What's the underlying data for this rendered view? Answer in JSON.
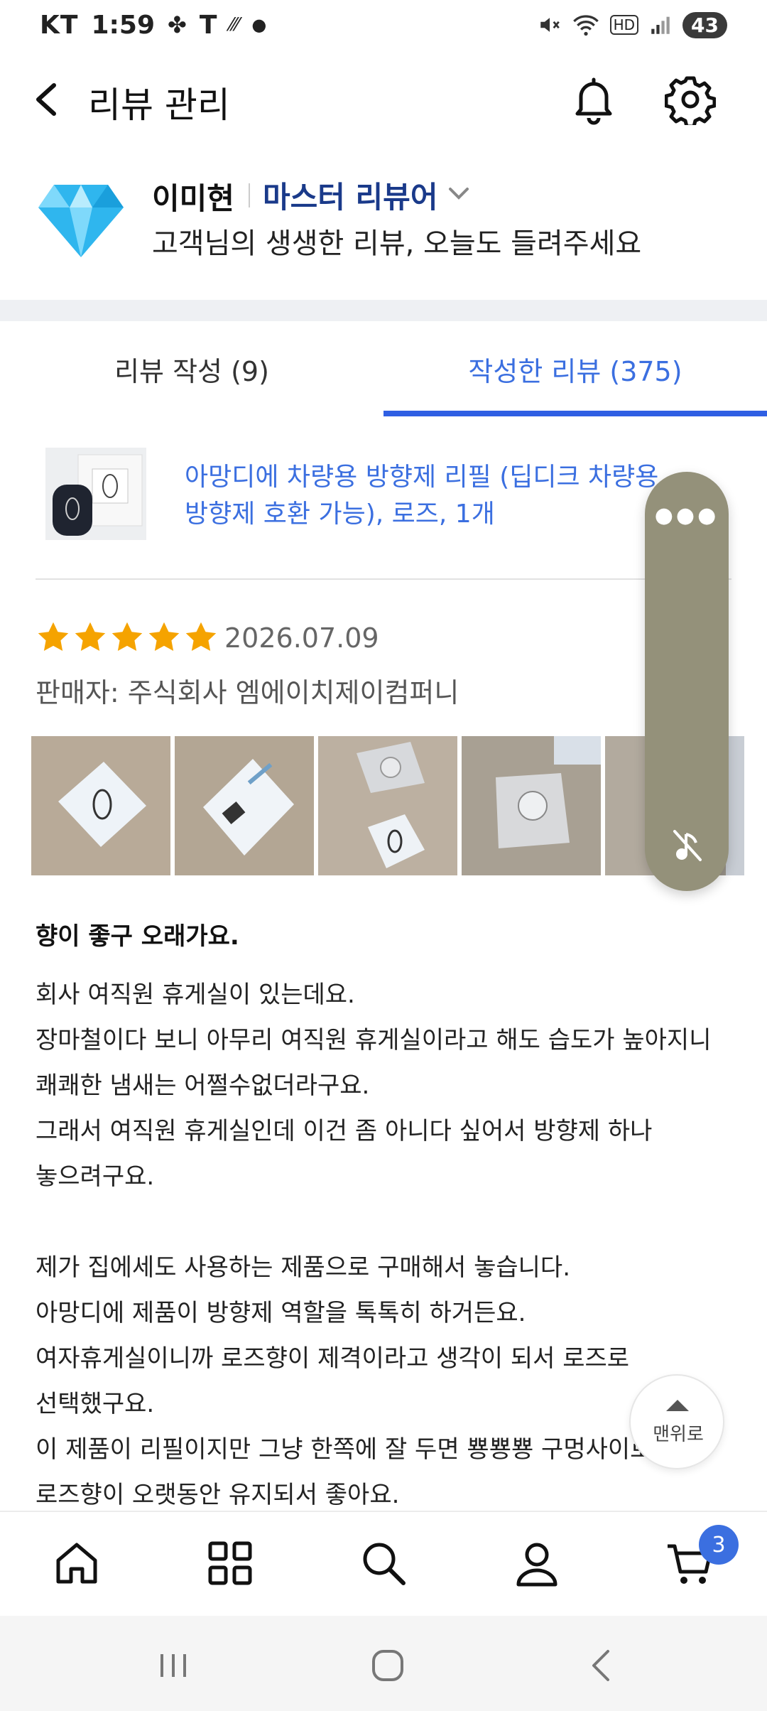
{
  "status_bar": {
    "carrier": "KT",
    "time": "1:59",
    "battery": "43"
  },
  "header": {
    "title": "리뷰 관리"
  },
  "profile": {
    "name": "이미현",
    "level": "마스터 리뷰어",
    "message": "고객님의 생생한 리뷰, 오늘도 들려주세요"
  },
  "tabs": [
    {
      "label": "리뷰 작성 (9)",
      "active": false
    },
    {
      "label": "작성한 리뷰 (375)",
      "active": true
    }
  ],
  "review": {
    "product_name": "아망디에 차량용 방향제 리필 (딥디크 차량용 방향제 호환 가능), 로즈, 1개",
    "rating": 5,
    "date": "2026.07.09",
    "seller": "판매자: 주식회사 엠에이치제이컴퍼니",
    "photo_count": 5,
    "title": "향이 좋구 오래가요.",
    "body_lines": [
      "회사 여직원 휴게실이 있는데요.",
      "장마철이다 보니 아무리 여직원 휴게실이라고 해도 습도가 높아지니",
      "쾌쾌한 냄새는 어쩔수없더라구요.",
      "그래서 여직원 휴게실인데 이건 좀 아니다 싶어서 방향제 하나",
      "놓으려구요.",
      "",
      "제가 집에세도 사용하는 제품으로 구매해서 놓습니다.",
      "아망디에 제품이 방향제 역할을 톡톡히 하거든요.",
      "여자휴게실이니까 로즈향이 제격이라고 생각이 되서 로즈로",
      "선택했구요.",
      "이 제품이 리필이지만 그냥 한쪽에 잘 두면 뿅뿅뿅 구멍사이로",
      "로즈향이 오랫동안 유지되서 좋아요."
    ]
  },
  "scroll_top": {
    "label": "맨위로"
  },
  "bottom_nav": {
    "cart_count": "3"
  },
  "colors": {
    "accent": "#3b6fe0",
    "level": "#1a3a8a",
    "star": "#f5a300",
    "pill": "#94917a"
  },
  "icons": [
    "back-arrow-icon",
    "bell-icon",
    "gear-icon",
    "diamond-badge-icon",
    "chevron-down-icon",
    "star-icon",
    "more-icon",
    "mute-icon",
    "home-icon",
    "grid-icon",
    "search-icon",
    "user-icon",
    "cart-icon"
  ]
}
